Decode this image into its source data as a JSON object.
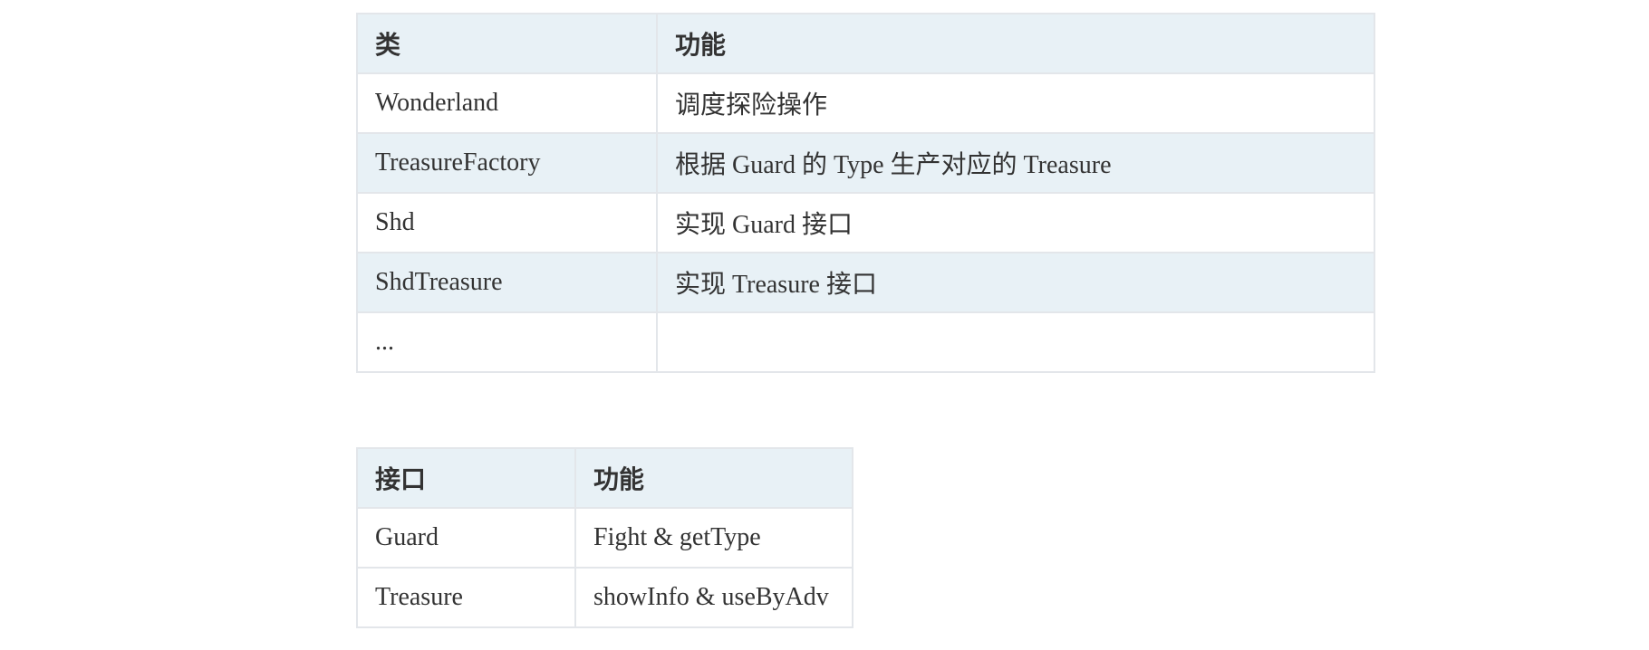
{
  "class_table": {
    "headers": [
      "类",
      "功能"
    ],
    "rows": [
      [
        "Wonderland",
        "调度探险操作"
      ],
      [
        "TreasureFactory",
        "根据 Guard 的 Type 生产对应的 Treasure"
      ],
      [
        "Shd",
        "实现 Guard 接口"
      ],
      [
        "ShdTreasure",
        "实现 Treasure 接口"
      ],
      [
        "...",
        ""
      ]
    ]
  },
  "interface_table": {
    "headers": [
      "接口",
      "功能"
    ],
    "rows": [
      [
        "Guard",
        "Fight & getType"
      ],
      [
        "Treasure",
        "showInfo & useByAdv"
      ]
    ]
  }
}
